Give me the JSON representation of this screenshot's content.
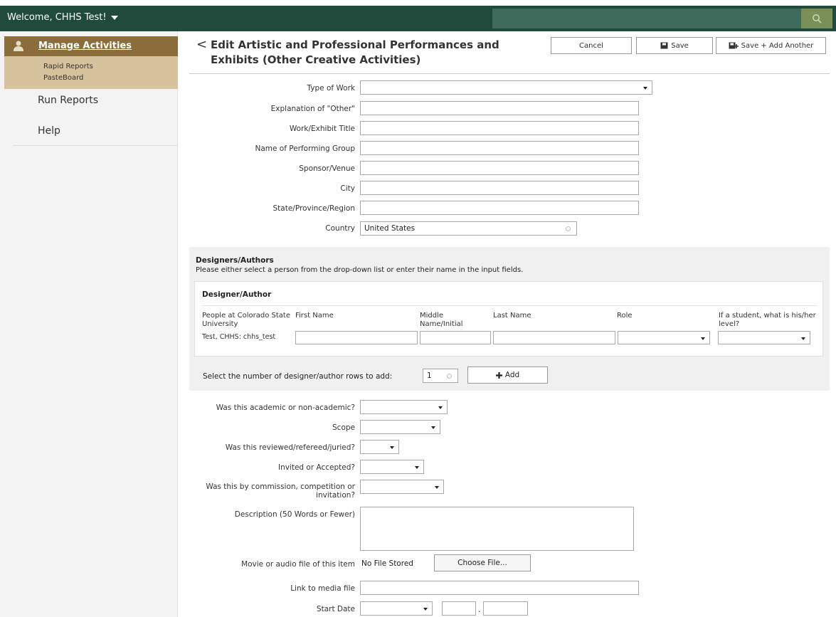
{
  "topbar": {
    "welcome": "Welcome, CHHS Test!",
    "search_placeholder": ""
  },
  "sidebar": {
    "active": "Manage Activities",
    "sub_items": [
      "Rapid Reports",
      "PasteBoard"
    ],
    "links": [
      "Run Reports",
      "Help"
    ]
  },
  "header": {
    "title": "Edit Artistic and Professional Performances and Exhibits (Other Creative Activities)",
    "cancel": "Cancel",
    "save": "Save",
    "save_add": "Save + Add Another"
  },
  "form": {
    "type_of_work": "Type of Work",
    "explanation_other": "Explanation of \"Other\"",
    "title": "Work/Exhibit Title",
    "performing_group": "Name of Performing Group",
    "sponsor_venue": "Sponsor/Venue",
    "city": "City",
    "state": "State/Province/Region",
    "country": "Country",
    "country_value": "United States"
  },
  "designers": {
    "title": "Designers/Authors",
    "description": "Please either select a person from the drop-down list or enter their name in the input fields.",
    "box_title": "Designer/Author",
    "columns": {
      "people": "People at Colorado State University",
      "first": "First Name",
      "middle": "Middle Name/Initial",
      "last": "Last Name",
      "role": "Role",
      "student": "If a student, what is his/her level?"
    },
    "person_value": "Test, CHHS: chhs_test",
    "rows_label": "Select the number of designer/author rows to add:",
    "rows_value": "1",
    "add_label": "Add"
  },
  "form2": {
    "academic": "Was this academic or non-academic?",
    "scope": "Scope",
    "reviewed": "Was this reviewed/refereed/juried?",
    "invited": "Invited or Accepted?",
    "commission": "Was this by commission, competition or invitation?",
    "description": "Description (50 Words or Fewer)",
    "media_file": "Movie or audio file of this item",
    "no_file": "No File Stored",
    "choose_file": "Choose File...",
    "link_media": "Link to media file",
    "start_date": "Start Date"
  },
  "colors": {
    "topbar": "#1f4a3c",
    "sidebar_head": "#8a6d3b",
    "sidebar_active": "#d6c29c"
  }
}
